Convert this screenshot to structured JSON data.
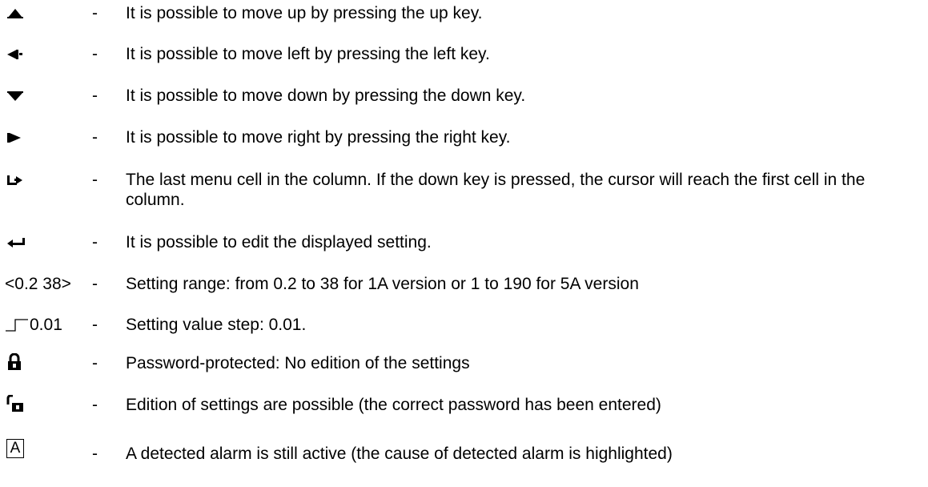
{
  "items": [
    {
      "icon": "up-arrow-icon",
      "separator": "-",
      "description": "It is possible to move up by pressing the up key."
    },
    {
      "icon": "left-arrow-icon",
      "separator": "-",
      "description": "It is possible to move left by pressing the left key."
    },
    {
      "icon": "down-arrow-icon",
      "separator": "-",
      "description": "It is possible to move down by pressing the down key."
    },
    {
      "icon": "right-arrow-icon",
      "separator": "-",
      "description": "It is possible to move right by pressing the right key."
    },
    {
      "icon": "wrap-around-icon",
      "separator": "-",
      "description": "The last menu cell in the column. If the down key is pressed, the cursor will reach the first cell in the column."
    },
    {
      "icon": "enter-key-icon",
      "separator": "-",
      "description": "It is possible to edit the displayed setting."
    },
    {
      "symbol_text": "<0.2 38>",
      "separator": "-",
      "description": "Setting range: from 0.2 to 38 for 1A version or 1 to 190 for 5A version"
    },
    {
      "icon": "step-icon",
      "symbol_text": "0.01",
      "separator": "-",
      "description": "Setting value step: 0.01."
    },
    {
      "icon": "padlock-closed-icon",
      "separator": "-",
      "description": "Password-protected: No edition of the settings"
    },
    {
      "icon": "padlock-open-icon",
      "separator": "-",
      "description": "Edition of settings are possible (the correct password has been entered)"
    },
    {
      "symbol_text": "A",
      "separator": "-",
      "description": "A detected alarm is still active (the cause of detected alarm is highlighted)"
    }
  ]
}
